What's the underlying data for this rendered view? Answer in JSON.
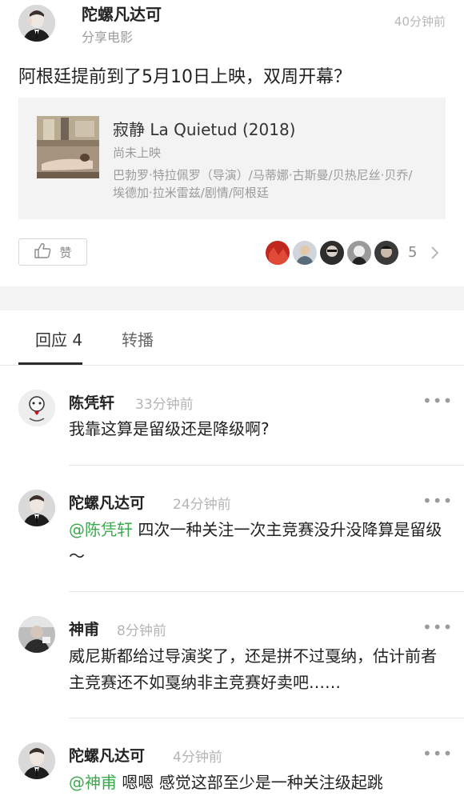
{
  "post": {
    "author": "陀螺凡达可",
    "action": "分享电影",
    "time": "40分钟前",
    "text": "阿根廷提前到了5月10日上映，双周开幕？"
  },
  "movie_card": {
    "title": "寂静 La Quietud (2018)",
    "status": "尚未上映",
    "credits": "巴勃罗·特拉佩罗（导演）/马蒂娜·古斯曼/贝热尼丝·贝乔/埃德加·拉米雷兹/剧情/阿根廷"
  },
  "like": {
    "label": "赞",
    "icon": "thumbs-up-icon"
  },
  "likers": {
    "count": "5"
  },
  "tabs": [
    {
      "label": "回应 4"
    },
    {
      "label": "转播"
    }
  ],
  "comments": [
    {
      "author": "陈凭轩",
      "time": "33分钟前",
      "mention": "",
      "text": "我靠这算是留级还是降级啊?"
    },
    {
      "author": "陀螺凡达可",
      "time": "24分钟前",
      "mention": "@陈凭轩",
      "text": " 四次一种关注一次主竞赛没升没降算是留级～"
    },
    {
      "author": "神甫",
      "time": "8分钟前",
      "mention": "",
      "text": "威尼斯都给过导演奖了，还是拼不过戛纳，估计前者主竞赛还不如戛纳非主竞赛好卖吧……"
    },
    {
      "author": "陀螺凡达可",
      "time": "4分钟前",
      "mention": "@神甫",
      "text": " 嗯嗯 感觉这部至少是一种关注级起跳"
    }
  ],
  "more_label": "•••",
  "colors": {
    "mention": "#3ba94d",
    "text": "#222222",
    "muted": "#9b9b9b"
  }
}
